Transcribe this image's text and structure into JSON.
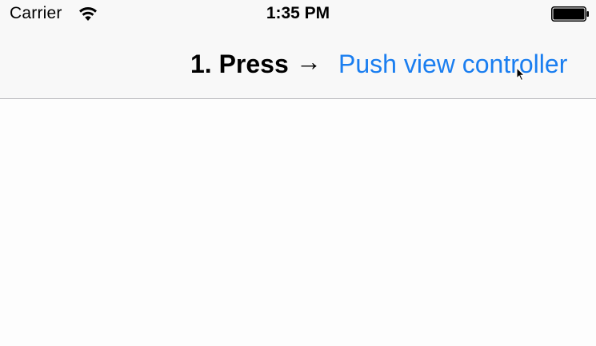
{
  "status_bar": {
    "carrier": "Carrier",
    "time": "1:35 PM",
    "wifi_icon": "wifi-icon",
    "battery_icon": "battery-icon"
  },
  "nav_bar": {
    "instruction": "1. Press",
    "arrow": "→",
    "push_button_label": "Push view controller"
  },
  "colors": {
    "accent": "#1a7ef0",
    "bar_background": "#f8f8f8",
    "separator": "#b9b9bd",
    "content_background": "#fdfdfd"
  }
}
